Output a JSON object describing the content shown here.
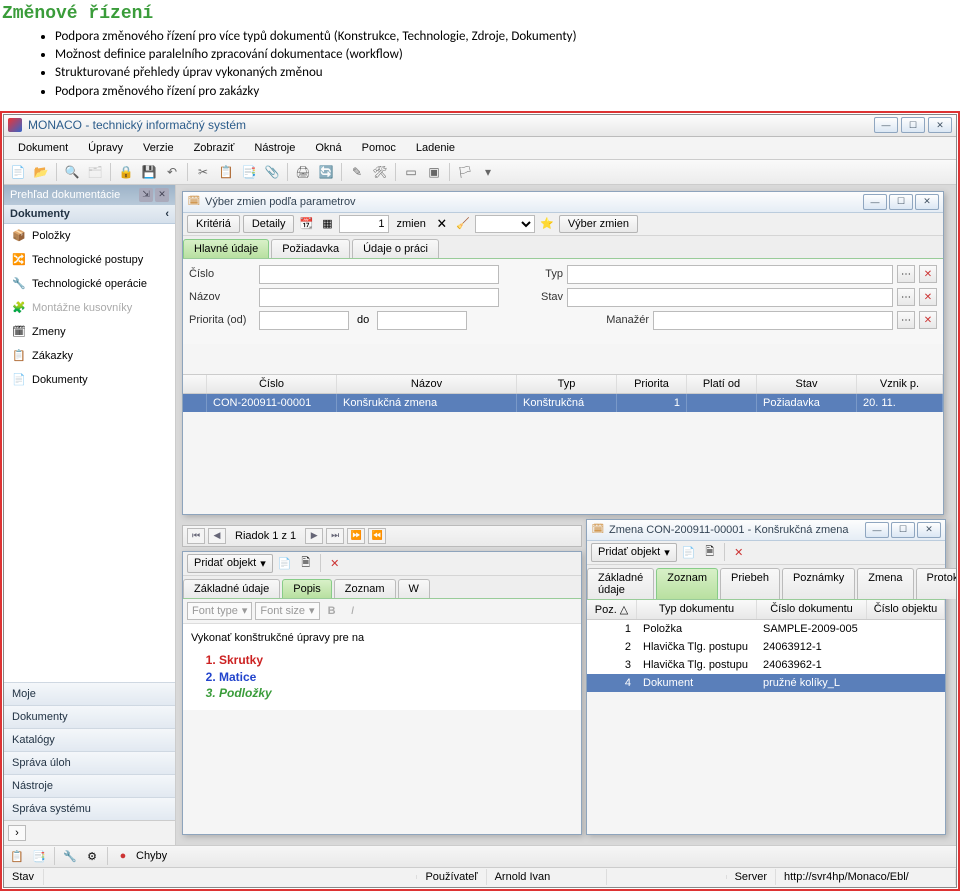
{
  "doc": {
    "title": "Změnové řízení",
    "bullets": [
      "Podpora změnového řízení pro více typů dokumentů (Konstrukce, Technologie, Zdroje, Dokumenty)",
      "Možnost definice paralelního zpracování dokumentace (workflow)",
      "Strukturované přehledy úprav vykonaných změnou",
      "Podpora změnového řízení pro zakázky"
    ]
  },
  "app": {
    "title": "MONACO - technický informačný systém",
    "menu": [
      "Dokument",
      "Úpravy",
      "Verzie",
      "Zobraziť",
      "Nástroje",
      "Okná",
      "Pomoc",
      "Ladenie"
    ]
  },
  "sidebar": {
    "header": "Prehľad dokumentácie",
    "section": "Dokumenty",
    "items": [
      {
        "label": "Položky",
        "icon": "📦"
      },
      {
        "label": "Technologické postupy",
        "icon": "🔀"
      },
      {
        "label": "Technologické operácie",
        "icon": "🔧"
      },
      {
        "label": "Montážne kusovníky",
        "icon": "🧩",
        "disabled": true
      },
      {
        "label": "Zmeny",
        "icon": "🗓"
      },
      {
        "label": "Zákazky",
        "icon": "📋"
      },
      {
        "label": "Dokumenty",
        "icon": "📄"
      }
    ],
    "accordion": [
      "Moje",
      "Dokumenty",
      "Katalógy",
      "Správa úloh",
      "Nástroje",
      "Správa systému"
    ]
  },
  "win1": {
    "title": "Výber zmien podľa parametrov",
    "btn_kriteria": "Kritériá",
    "btn_detaily": "Detaily",
    "count_val": "1",
    "count_lbl": "zmien",
    "btn_vyber": "Výber zmien",
    "tabs": [
      "Hlavné údaje",
      "Požiadavka",
      "Údaje o práci"
    ],
    "labels": {
      "cislo": "Číslo",
      "typ": "Typ",
      "nazov": "Názov",
      "stav": "Stav",
      "prio_od": "Priorita (od)",
      "do": "do",
      "manazer": "Manažér"
    },
    "cols": [
      "",
      "Číslo",
      "Názov",
      "Typ",
      "Priorita",
      "Platí od",
      "Stav",
      "Vznik p."
    ],
    "row": [
      "",
      "CON-200911-00001",
      "Konšrukčná zmena",
      "Konštrukčná",
      "1",
      "",
      "Požiadavka",
      "20. 11."
    ]
  },
  "pager": {
    "label": "Riadok 1 z 1"
  },
  "win2": {
    "btn_pridat": "Pridať objekt",
    "tabs": [
      "Základné údaje",
      "Popis",
      "Zoznam",
      "W"
    ],
    "font_type": "Font type",
    "font_size": "Font size",
    "text": "Vykonať konštrukčné úpravy pre na",
    "items": [
      "Skrutky",
      "Matice",
      "Podložky"
    ]
  },
  "win3": {
    "title": "Zmena CON-200911-00001 - Konšrukčná zmena",
    "btn_pridat": "Pridať objekt",
    "tabs": [
      "Základné údaje",
      "Zoznam",
      "Priebeh",
      "Poznámky",
      "Zmena",
      "Protokol"
    ],
    "cols": [
      "Poz. △",
      "Typ dokumentu",
      "Číslo dokumentu",
      "Číslo objektu"
    ],
    "rows": [
      [
        "1",
        "Položka",
        "SAMPLE-2009-005",
        ""
      ],
      [
        "2",
        "Hlavička Tlg. postupu",
        "24063912-1",
        ""
      ],
      [
        "3",
        "Hlavička Tlg. postupu",
        "24063962-1",
        ""
      ],
      [
        "4",
        "Dokument",
        "pružné kolíky_L",
        ""
      ]
    ],
    "selected": 3
  },
  "status": {
    "chyby": "Chyby",
    "stav_lbl": "Stav",
    "user_lbl": "Používateľ",
    "user_val": "Arnold Ivan",
    "server_lbl": "Server",
    "server_val": "http://svr4hp/Monaco/Ebl/"
  }
}
